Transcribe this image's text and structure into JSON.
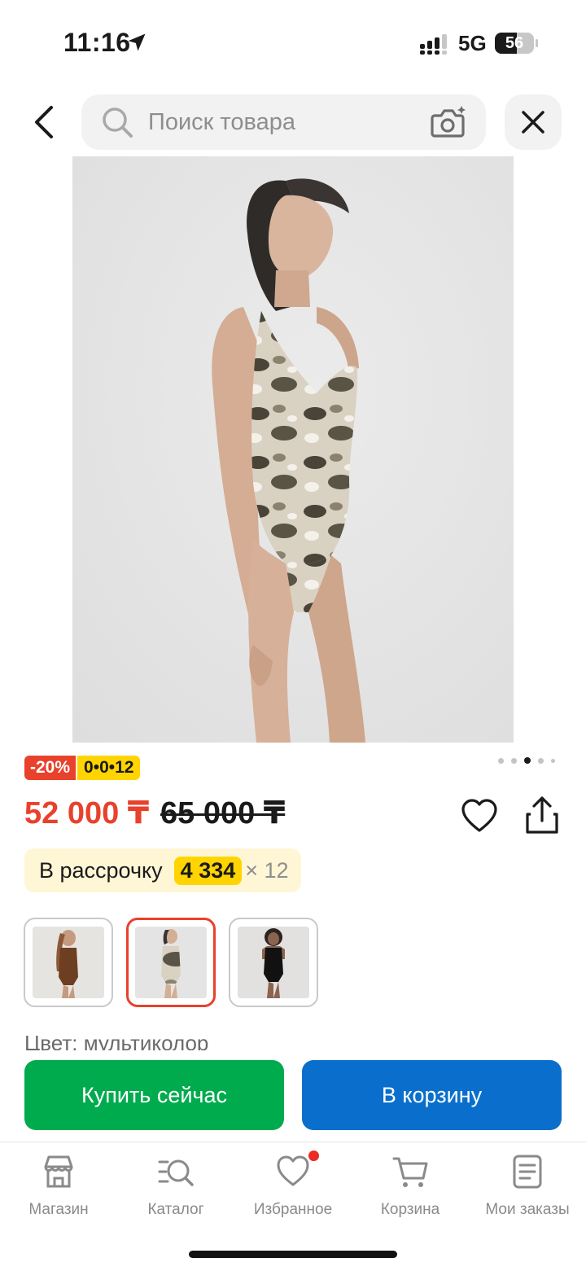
{
  "status_bar": {
    "time": "11:16",
    "network": "5G",
    "battery_percent": "56",
    "battery_level": 0.56
  },
  "header": {
    "search_placeholder": "Поиск товара",
    "icons": [
      "chevron-left-icon",
      "search-icon",
      "camera-icon",
      "close-icon"
    ]
  },
  "product": {
    "image_count": 5,
    "active_image_index": 2,
    "discount_badge": "-20%",
    "installment_badge": "0•0•12",
    "price_current": "52 000 ₸",
    "price_old": "65 000 ₸",
    "installment": {
      "label": "В рассрочку",
      "amount": "4 334",
      "times": "× 12"
    },
    "variants": [
      {
        "color": "brown",
        "selected": false
      },
      {
        "color": "multicolor",
        "selected": true
      },
      {
        "color": "black",
        "selected": false
      }
    ],
    "color_label": "Цвет: мультиколор"
  },
  "actions": {
    "buy_now": "Купить сейчас",
    "add_to_cart": "В корзину"
  },
  "bottom_nav": {
    "items": [
      {
        "label": "Магазин",
        "icon": "store-icon"
      },
      {
        "label": "Каталог",
        "icon": "catalog-search-icon"
      },
      {
        "label": "Избранное",
        "icon": "heart-icon",
        "has_notification": true
      },
      {
        "label": "Корзина",
        "icon": "cart-icon"
      },
      {
        "label": "Мои заказы",
        "icon": "orders-icon"
      }
    ]
  },
  "colors": {
    "accent_red": "#e8412c",
    "badge_yellow": "#ffd400",
    "buy_green": "#00ab4e",
    "cart_blue": "#0a6fcc"
  }
}
